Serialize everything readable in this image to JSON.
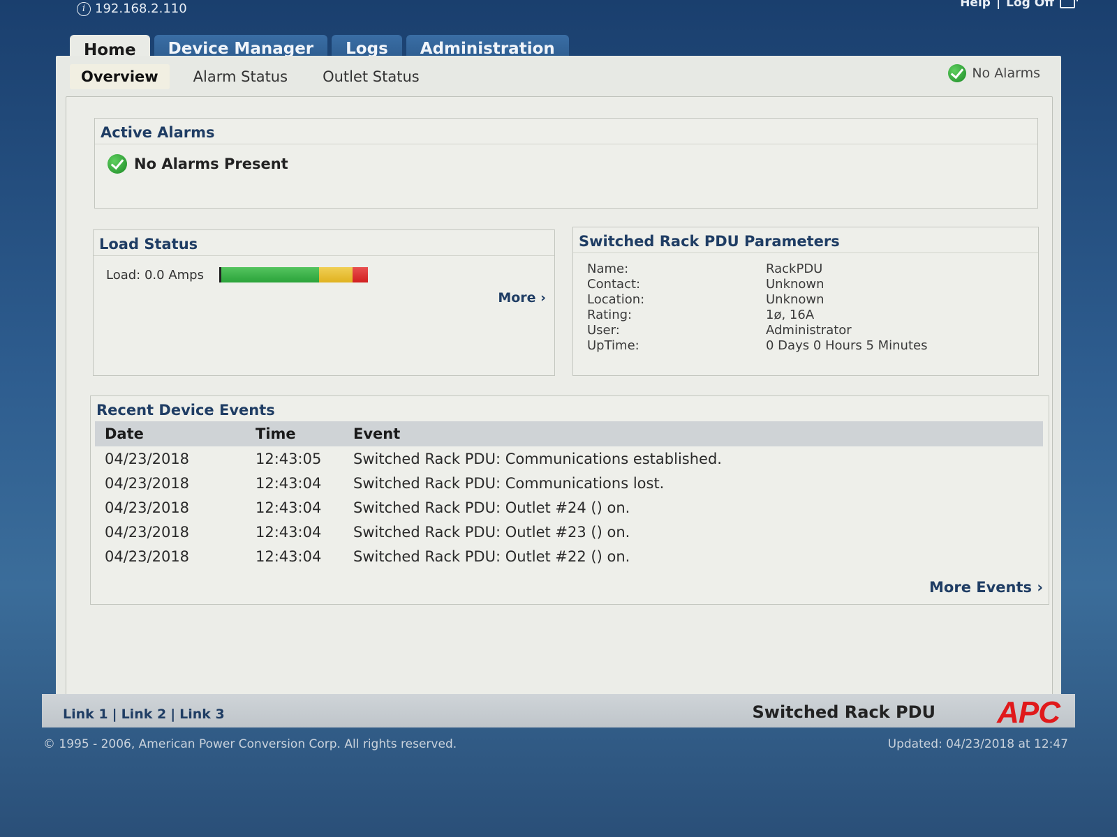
{
  "topbar": {
    "ip_address": "192.168.2.110",
    "help_label": "Help",
    "separator": "|",
    "logoff_label": "Log Off"
  },
  "tabs": [
    {
      "label": "Home",
      "active": true
    },
    {
      "label": "Device Manager",
      "active": false
    },
    {
      "label": "Logs",
      "active": false
    },
    {
      "label": "Administration",
      "active": false
    }
  ],
  "subnav": [
    {
      "label": "Overview",
      "active": true
    },
    {
      "label": "Alarm Status",
      "active": false
    },
    {
      "label": "Outlet Status",
      "active": false
    }
  ],
  "alarm_summary": "No Alarms",
  "active_alarms": {
    "title": "Active Alarms",
    "message": "No Alarms Present"
  },
  "load_status": {
    "title": "Load Status",
    "label": "Load: 0.0 Amps",
    "load_value_fraction": 0.0,
    "more_label": "More ›",
    "bar_colors": [
      "#2aa33a",
      "#e0b21f",
      "#d11f1f"
    ]
  },
  "pdu_params": {
    "title": "Switched Rack PDU Parameters",
    "rows": [
      {
        "key": "Name:",
        "value": "RackPDU"
      },
      {
        "key": "Contact:",
        "value": "Unknown"
      },
      {
        "key": "Location:",
        "value": "Unknown"
      },
      {
        "key": "Rating:",
        "value": "1ø, 16A"
      },
      {
        "key": "User:",
        "value": "Administrator"
      },
      {
        "key": "UpTime:",
        "value": "0 Days 0 Hours 5 Minutes"
      }
    ]
  },
  "recent_events": {
    "title": "Recent Device Events",
    "columns": [
      "Date",
      "Time",
      "Event"
    ],
    "rows": [
      [
        "04/23/2018",
        "12:43:05",
        "Switched Rack PDU: Communications established."
      ],
      [
        "04/23/2018",
        "12:43:04",
        "Switched Rack PDU: Communications lost."
      ],
      [
        "04/23/2018",
        "12:43:04",
        "Switched Rack PDU: Outlet #24 () on."
      ],
      [
        "04/23/2018",
        "12:43:04",
        "Switched Rack PDU: Outlet #23 () on."
      ],
      [
        "04/23/2018",
        "12:43:04",
        "Switched Rack PDU: Outlet #22 () on."
      ]
    ],
    "more_label": "More Events ›"
  },
  "footer": {
    "links": [
      "Link 1",
      "Link 2",
      "Link 3"
    ],
    "product_name": "Switched Rack PDU",
    "brand": "APC",
    "copyright": "© 1995 - 2006, American Power Conversion Corp. All rights reserved.",
    "updated": "Updated: 04/23/2018 at 12:47"
  },
  "colors": {
    "accent": "#1f3d64",
    "brand_red": "#e0191b",
    "ok_green": "#1c8a26"
  }
}
